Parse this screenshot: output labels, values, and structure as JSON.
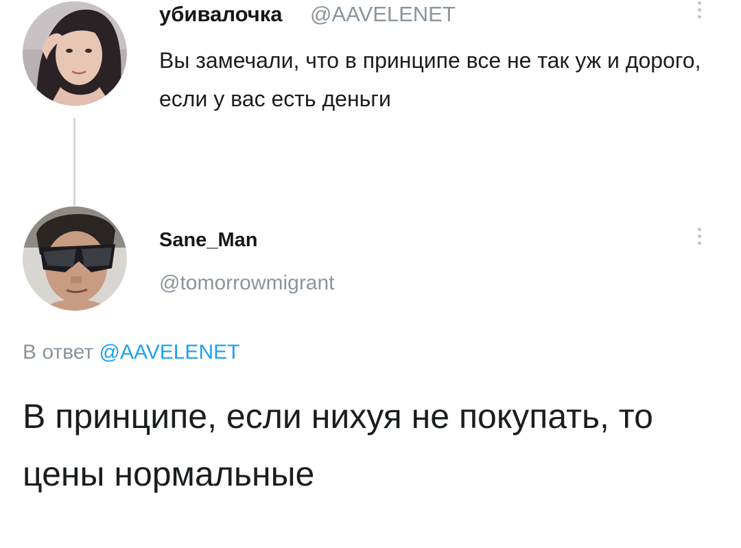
{
  "parent_tweet": {
    "display_name": "убивалочка",
    "handle": "@AAVELENET",
    "text": "Вы замечали, что в принципе все не так уж и дорого, если у вас есть деньги",
    "avatar_icon": "avatar-woman-photo"
  },
  "reply_tweet": {
    "display_name": "Sane_Man",
    "handle": "@tomorrowmigrant",
    "reply_prefix": "В ответ",
    "reply_to_handle": "@AAVELENET",
    "text": "В принципе, если нихуя не покупать, то цены нормальные",
    "avatar_icon": "avatar-man-sunglasses-photo"
  },
  "icons": {
    "more_options": "vertical-ellipsis-icon"
  },
  "colors": {
    "text": "#14171a",
    "secondary_text": "#8a949c",
    "link": "#1da1f2",
    "thread_line": "#cfd6dc"
  }
}
